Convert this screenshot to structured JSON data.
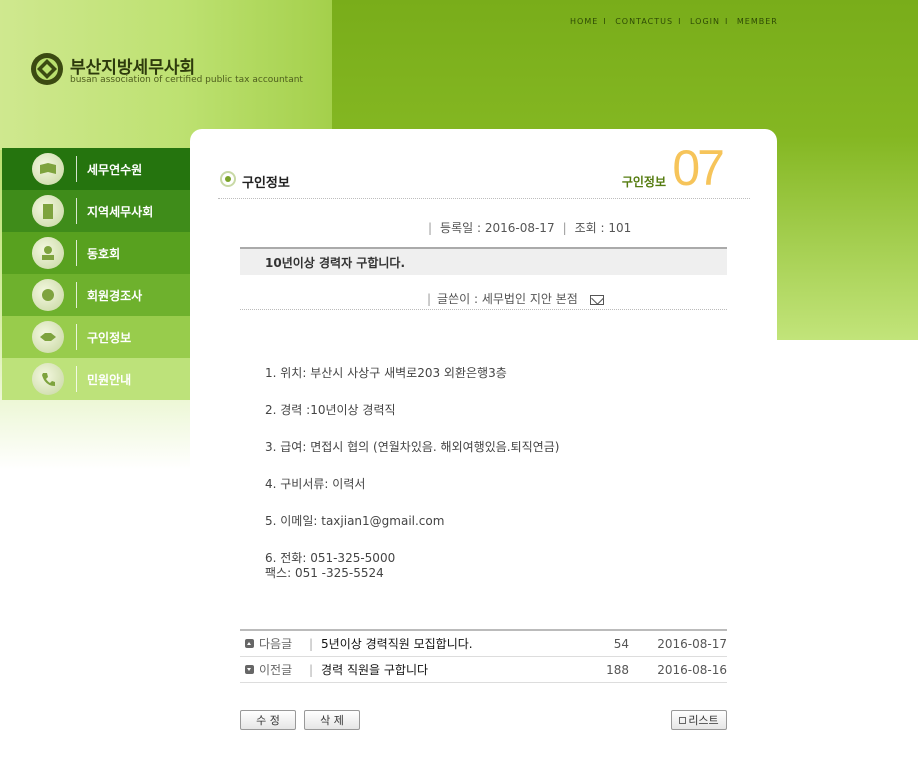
{
  "top_nav": {
    "items": [
      "HOME",
      "CONTACTUS",
      "LOGIN",
      "MEMBER"
    ]
  },
  "logo": {
    "title": "부산지방세무사회",
    "subtitle": "busan association of certified public tax accountant"
  },
  "sidebar": {
    "items": [
      {
        "label": "세무연수원",
        "bg": "#25740e"
      },
      {
        "label": "지역세무사회",
        "bg": "#3f8c1a"
      },
      {
        "label": "동호회",
        "bg": "#58a11f"
      },
      {
        "label": "회원경조사",
        "bg": "#6eb12d"
      },
      {
        "label": "구인정보",
        "bg": "#98cc4c"
      },
      {
        "label": "민원안내",
        "bg": "#bde27a"
      }
    ]
  },
  "page": {
    "title": "구인정보",
    "section_label": "구인정보",
    "section_number": "07"
  },
  "post": {
    "meta_date_label": "등록일 : 2016-08-17",
    "meta_views_label": "조회 : 101",
    "subject": "10년이상 경력자 구합니다.",
    "writer": "글쓴이 : 세무법인 지안 본점",
    "body": [
      "1. 위치: 부산시 사상구 새벽로203 외환은행3층",
      "2. 경력 :10년이상 경력직",
      "3. 급여: 면접시 협의 (연월차있음. 해외여행있음.퇴직연금)",
      "4. 구비서류: 이력서",
      "5. 이메일: taxjian1@gmail.com",
      "6. 전화: 051-325-5000",
      "팩스: 051 -325-5524"
    ]
  },
  "post_nav": [
    {
      "kind": "다음글",
      "title": "5년이상 경력직원 모집합니다.",
      "count": "54",
      "date": "2016-08-17"
    },
    {
      "kind": "이전글",
      "title": "경력 직원을 구합니다",
      "count": "188",
      "date": "2016-08-16"
    }
  ],
  "buttons": {
    "edit": "수 정",
    "delete": "삭 제",
    "list": "리스트"
  }
}
